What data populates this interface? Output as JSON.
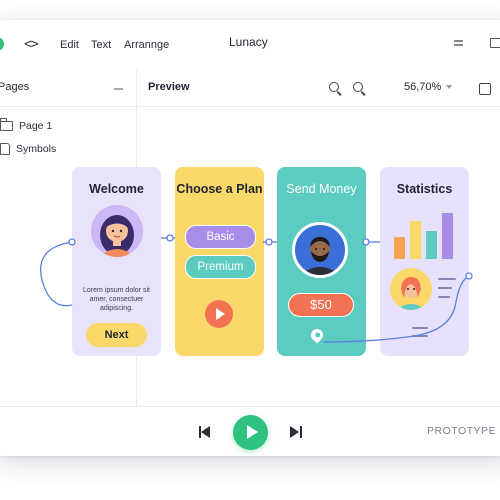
{
  "app": {
    "title": "Lunacy",
    "menu": [
      "Edit",
      "Text",
      "Arrannge"
    ]
  },
  "sidebar": {
    "header": "Pages",
    "items": [
      {
        "label": "Page 1",
        "icon": "folder-icon"
      },
      {
        "label": "Symbols",
        "icon": "document-icon"
      }
    ]
  },
  "preview": {
    "label": "Preview",
    "zoom": "56,70%"
  },
  "cards": {
    "welcome": {
      "title": "Welcome",
      "body": "Lorem ipsum dolor sit amer, consectuer adipiscing.",
      "button": "Next"
    },
    "plan": {
      "title": "Choose a Plan",
      "option1": "Basic",
      "option2": "Premium"
    },
    "send": {
      "title": "Send Money",
      "amount": "$50"
    },
    "stats": {
      "title": "Statistics"
    }
  },
  "playback": {
    "mode": "PROTOTYPE"
  },
  "colors": {
    "accent_green": "#2ec27e",
    "lavender": "#e9e2fb",
    "yellow": "#fbd86a",
    "teal": "#5dccc0",
    "coral": "#f27254",
    "purple": "#a98ce8"
  }
}
